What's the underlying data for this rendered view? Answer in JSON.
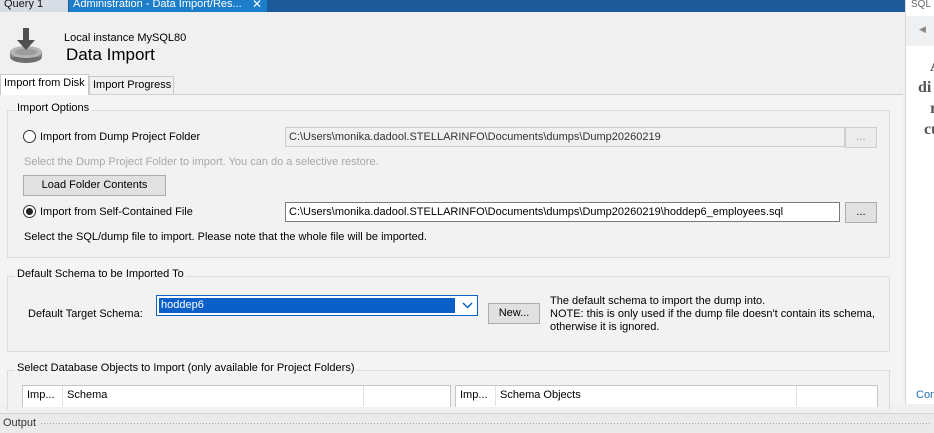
{
  "editor_tabs": [
    {
      "label": "Query 1"
    },
    {
      "label": "Administration - Data Import/Res..."
    }
  ],
  "side_panel": {
    "title": "SQL",
    "help_lines": [
      "A",
      "di",
      "r",
      "cu"
    ],
    "link": "Con"
  },
  "header": {
    "instance": "Local instance MySQL80",
    "title": "Data Import"
  },
  "subtabs": [
    {
      "label": "Import from Disk",
      "active": true
    },
    {
      "label": "Import Progress",
      "active": false
    }
  ],
  "import_options": {
    "title": "Import Options",
    "dump_folder": {
      "label": "Import from Dump Project Folder",
      "path": "C:\\Users\\monika.dadool.STELLARINFO\\Documents\\dumps\\Dump20260219",
      "browse_label": "...",
      "hint": "Select the Dump Project Folder to import. You can do a selective restore.",
      "load_button": "Load Folder Contents"
    },
    "self_contained": {
      "label": "Import from Self-Contained File",
      "path": "C:\\Users\\monika.dadool.STELLARINFO\\Documents\\dumps\\Dump20260219\\hoddep6_employees.sql",
      "browse_label": "...",
      "hint": "Select the SQL/dump file to import. Please note that the whole file will be imported."
    }
  },
  "default_schema": {
    "title": "Default Schema to be Imported To",
    "label": "Default Target Schema:",
    "value": "hoddep6",
    "new_button": "New...",
    "note_lines": [
      "The default schema to import the dump into.",
      "NOTE: this is only used if the dump file doesn't contain its schema,",
      "otherwise it is ignored."
    ]
  },
  "objects": {
    "title": "Select Database Objects to Import (only available for Project Folders)",
    "left_headers": [
      "Imp...",
      "Schema"
    ],
    "right_headers": [
      "Imp...",
      "Schema Objects"
    ]
  },
  "output": {
    "label": "Output"
  },
  "colors": {
    "tabbar": "#1c5a9a",
    "active_tab": "#1c7ec9",
    "selection": "#0a60c8"
  }
}
